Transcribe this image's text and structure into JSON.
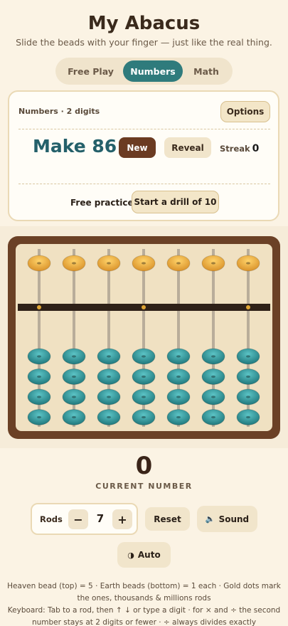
{
  "header": {
    "title": "My Abacus",
    "subtitle": "Slide the beads with your finger — just like the real thing."
  },
  "mode_tabs": [
    {
      "label": "Free Play",
      "active": false
    },
    {
      "label": "Numbers",
      "active": true
    },
    {
      "label": "Math",
      "active": false
    }
  ],
  "card": {
    "mode_label": "Numbers · 2 digits",
    "options_label": "Options",
    "target_label": "Make 86",
    "new_label": "New",
    "reveal_label": "Reveal",
    "streak_label": "Streak",
    "streak_value": "0",
    "free_practice_label": "Free practice",
    "drill_label": "Start a drill of 10"
  },
  "abacus": {
    "rods": 7,
    "heaven_beads_per_rod": 1,
    "earth_beads_per_rod": 4,
    "values": [
      0,
      0,
      0,
      0,
      0,
      0,
      0
    ],
    "gold_dot_rods": [
      0,
      3,
      6
    ],
    "colors": {
      "frame": "#6b4126",
      "board": "#f0e1c2",
      "bar": "#2f2118",
      "heaven_bead": "#f0b535",
      "earth_bead": "#37a3a7",
      "gold_dot": "#e0a534",
      "rod": "#b9ad9a"
    }
  },
  "current": {
    "value": "0",
    "label": "CURRENT NUMBER"
  },
  "controls": {
    "rods_label": "Rods",
    "minus_label": "−",
    "rods_value": "7",
    "plus_label": "+",
    "reset_label": "Reset",
    "sound_label": "Sound",
    "sound_icon": "speaker-icon",
    "auto_label": "Auto",
    "auto_icon": "half-moon-icon"
  },
  "footer": {
    "line1": "Heaven bead (top) = 5 · Earth beads (bottom) = 1 each · Gold dots mark the ones, thousands & millions rods",
    "line2": "Keyboard: Tab to a rod, then ↑ ↓ or type a digit · for × and ÷ the second number stays at 2 digits or fewer · ÷ always divides exactly"
  }
}
